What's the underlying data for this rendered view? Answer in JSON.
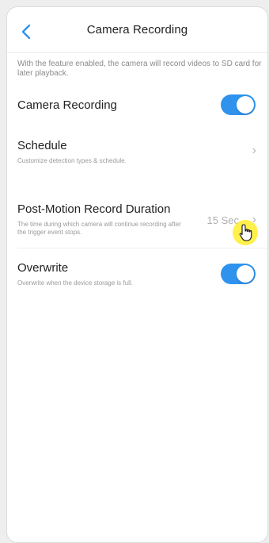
{
  "header": {
    "title": "Camera Recording",
    "back_icon": "chevron-left-icon"
  },
  "intro": {
    "text": "With the feature enabled, the camera will record videos to SD card for later playback."
  },
  "camera_recording": {
    "label": "Camera Recording",
    "enabled": true
  },
  "schedule": {
    "label": "Schedule",
    "description": "Customize detection types & schedule.",
    "chevron": "›"
  },
  "post_motion": {
    "label": "Post-Motion Record Duration",
    "description": "The time during which camera will continue recording after the trigger event stops.",
    "value": "15 Sec",
    "chevron": "›"
  },
  "overwrite": {
    "label": "Overwrite",
    "description": "Overwrite when the device storage is full.",
    "enabled": true
  },
  "colors": {
    "accent": "#2f93ee",
    "cursor_highlight": "#ffec1e"
  }
}
